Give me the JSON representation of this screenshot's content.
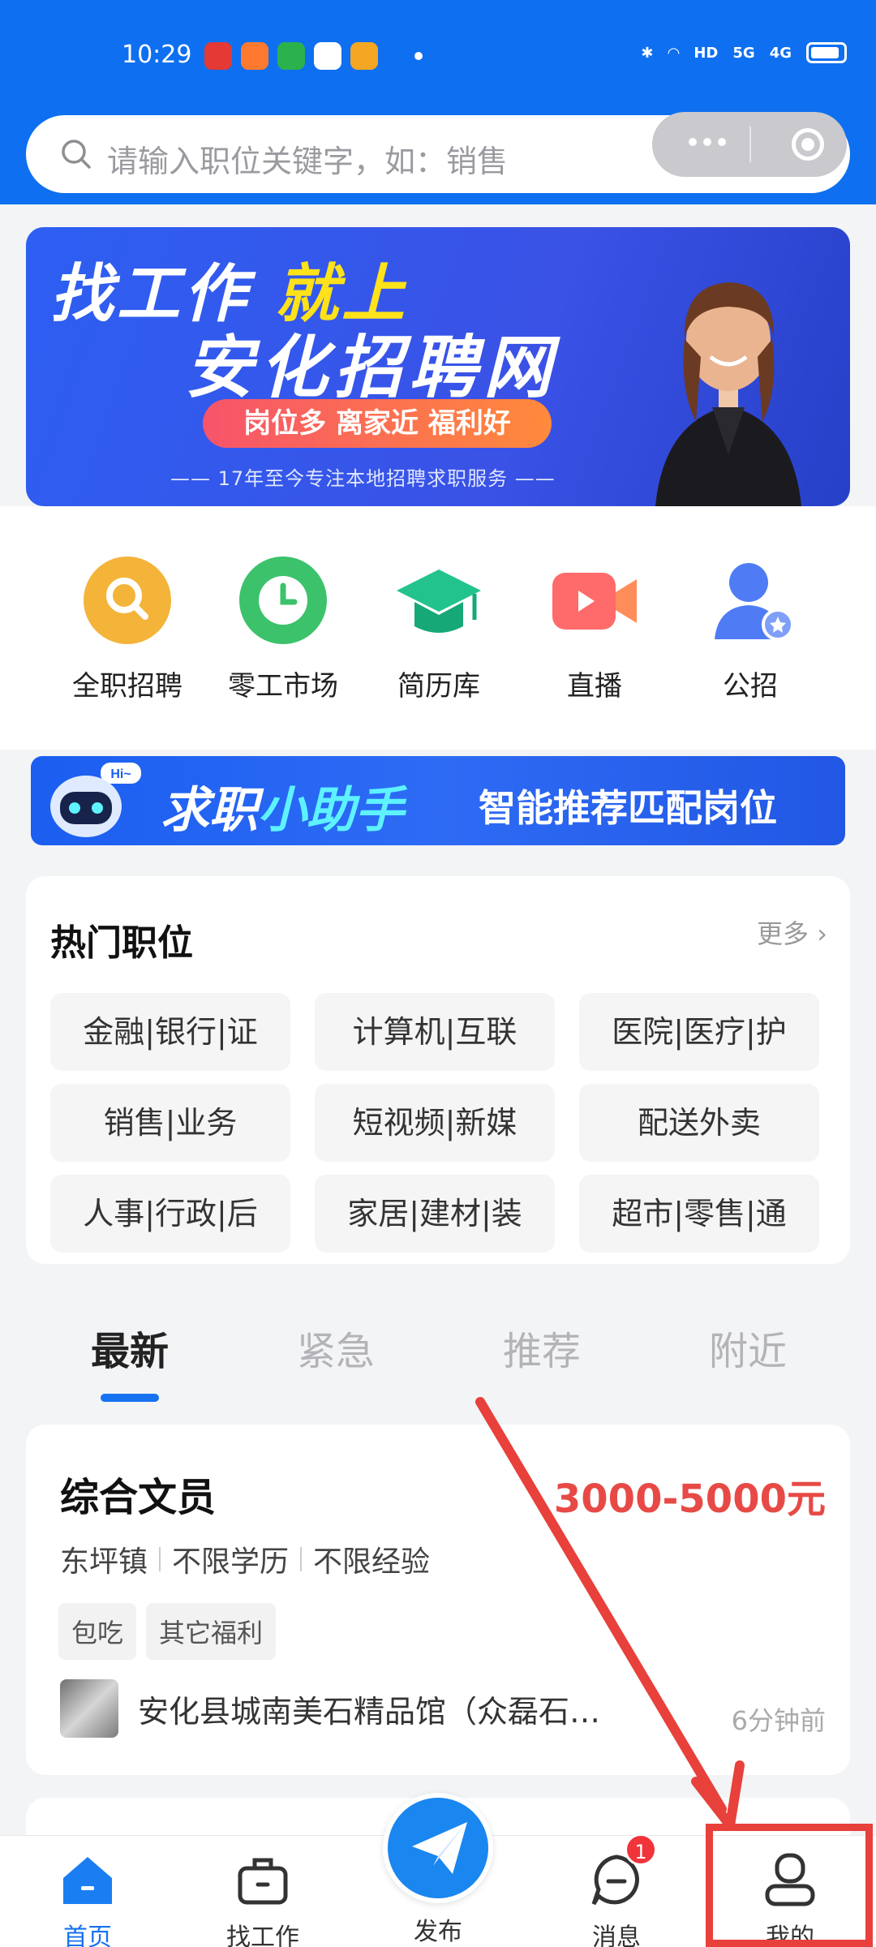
{
  "status_bar": {
    "time": "10:29",
    "network": "5G",
    "network2": "4G",
    "hd": "HD"
  },
  "search": {
    "placeholder": "请输入职位关键字，如：销售"
  },
  "banner": {
    "line1_white": "找工作",
    "line1_yellow": "就上",
    "line2": "安化招聘网",
    "pill": "岗位多 离家近 福利好",
    "sub": "—— 17年至今专注本地招聘求职服务 ——"
  },
  "categories": [
    {
      "label": "全职招聘",
      "icon": "search-icon"
    },
    {
      "label": "零工市场",
      "icon": "clock-icon"
    },
    {
      "label": "简历库",
      "icon": "graduation-cap-icon"
    },
    {
      "label": "直播",
      "icon": "video-camera-icon"
    },
    {
      "label": "公招",
      "icon": "user-badge-icon"
    }
  ],
  "assistant": {
    "hi": "Hi~",
    "title_a": "求职",
    "title_b": "小助手",
    "desc": "智能推荐匹配岗位"
  },
  "hot_jobs": {
    "title": "热门职位",
    "more": "更多",
    "tags": [
      "金融|银行|证",
      "计算机|互联",
      "医院|医疗|护",
      "销售|业务",
      "短视频|新媒",
      "配送外卖",
      "人事|行政|后",
      "家居|建材|装",
      "超市|零售|通"
    ]
  },
  "feed_tabs": [
    "最新",
    "紧急",
    "推荐",
    "附近"
  ],
  "job": {
    "title": "综合文员",
    "salary": "3000-5000元",
    "location": "东坪镇",
    "education": "不限学历",
    "experience": "不限经验",
    "welfare": [
      "包吃",
      "其它福利"
    ],
    "company": "安化县城南美石精品馆（众磊石…",
    "ago": "6分钟前"
  },
  "tabbar": {
    "home": "首页",
    "find": "找工作",
    "publish": "发布",
    "messages": "消息",
    "messages_badge": "1",
    "mine": "我的"
  },
  "colors": {
    "brand_blue": "#0e6ff0",
    "salary_red": "#e74a46",
    "annotation_red": "#e8403b"
  }
}
